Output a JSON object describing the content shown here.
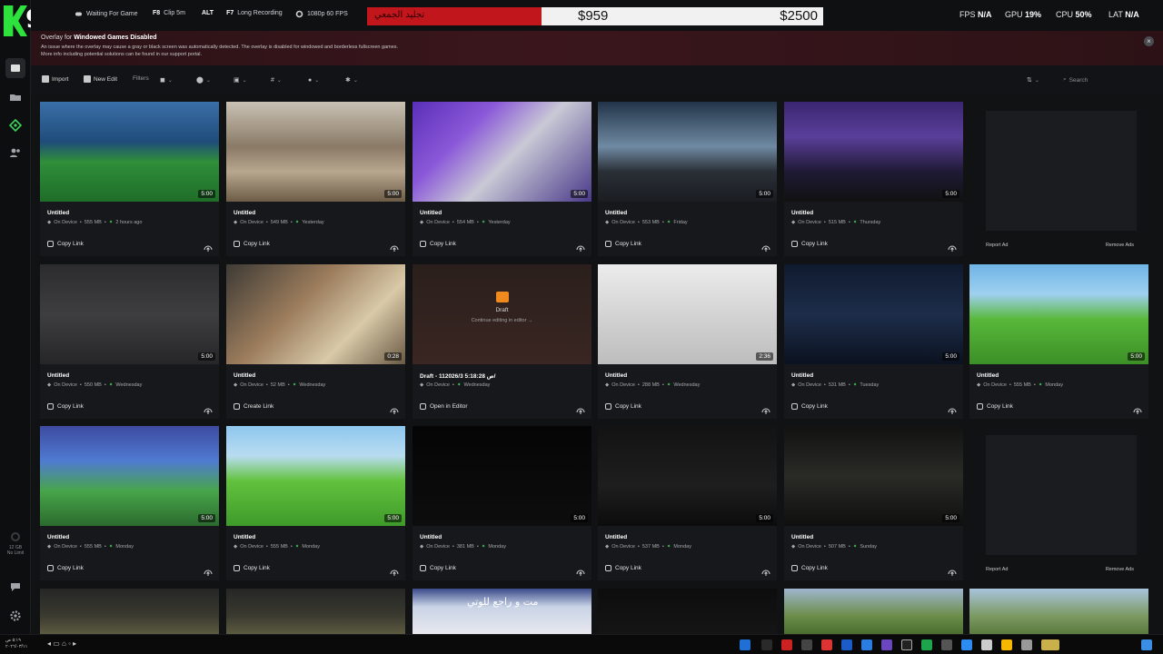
{
  "app": {
    "logo_text": "9"
  },
  "rail": {
    "storage_text": "12 GB",
    "limit_text": "No Limit"
  },
  "topbar": {
    "status": "Waiting For Game",
    "clip_key": "F8",
    "clip_label": "Clip 5m",
    "alt_key": "ALT",
    "long_key": "F7",
    "long_label": "Long Recording",
    "quality": "1080p 60 FPS",
    "bid_text": "تجليد الجمعي",
    "amount_current": "$959",
    "amount_goal": "$2500",
    "fps_label": "FPS",
    "fps_value": "N/A",
    "gpu_label": "GPU",
    "gpu_value": "19%",
    "cpu_label": "CPU",
    "cpu_value": "50%",
    "lat_label": "LAT",
    "lat_value": "N/A"
  },
  "banner": {
    "title_prefix": "Overlay for",
    "title_bold": "Windowed Games Disabled",
    "line1": "An issue where the overlay may cause a gray or black screen was automatically detected. The overlay is disabled for windowed and borderless fullscreen games.",
    "line2": "More info including potential solutions can be found in our support portal.",
    "close": "×"
  },
  "toolbar": {
    "import": "Import",
    "new_edit": "New Edit",
    "filters": "Filters",
    "search_placeholder": "Search"
  },
  "ads": {
    "report": "Report Ad",
    "remove": "Remove Ads"
  },
  "cards": [
    {
      "title": "Untitled",
      "size": "555 MB",
      "when": "2 hours ago",
      "duration": "5:00",
      "action": "Copy Link",
      "location": "On Device"
    },
    {
      "title": "Untitled",
      "size": "549 MB",
      "when": "Yesterday",
      "duration": "5:00",
      "action": "Copy Link",
      "location": "On Device"
    },
    {
      "title": "Untitled",
      "size": "554 MB",
      "when": "Yesterday",
      "duration": "5:00",
      "action": "Copy Link",
      "location": "On Device"
    },
    {
      "title": "Untitled",
      "size": "553 MB",
      "when": "Friday",
      "duration": "5:00",
      "action": "Copy Link",
      "location": "On Device"
    },
    {
      "title": "Untitled",
      "size": "515 MB",
      "when": "Thursday",
      "duration": "5:00",
      "action": "Copy Link",
      "location": "On Device"
    },
    {
      "title": "Untitled",
      "size": "550 MB",
      "when": "Wednesday",
      "duration": "5:00",
      "action": "Copy Link",
      "location": "On Device"
    },
    {
      "title": "Untitled",
      "size": "52 MB",
      "when": "Wednesday",
      "duration": "0:28",
      "action": "Create Link",
      "location": "On Device"
    },
    {
      "title": "Draft - 11ص 5:18:28 2026/3/",
      "size": "",
      "when": "Wednesday",
      "duration": "",
      "action": "Open in Editor",
      "location": "On Device",
      "draft_label": "Draft",
      "draft_sub": "Continue editing in editor →"
    },
    {
      "title": "Untitled",
      "size": "288 MB",
      "when": "Wednesday",
      "duration": "2:36",
      "action": "Copy Link",
      "location": "On Device"
    },
    {
      "title": "Untitled",
      "size": "531 MB",
      "when": "Tuesday",
      "duration": "5:00",
      "action": "Copy Link",
      "location": "On Device"
    },
    {
      "title": "Untitled",
      "size": "555 MB",
      "when": "Monday",
      "duration": "5:00",
      "action": "Copy Link",
      "location": "On Device"
    },
    {
      "title": "Untitled",
      "size": "555 MB",
      "when": "Monday",
      "duration": "5:00",
      "action": "Copy Link",
      "location": "On Device"
    },
    {
      "title": "Untitled",
      "size": "555 MB",
      "when": "Monday",
      "duration": "5:00",
      "action": "Copy Link",
      "location": "On Device"
    },
    {
      "title": "Untitled",
      "size": "381 MB",
      "when": "Monday",
      "duration": "5:00",
      "action": "Copy Link",
      "location": "On Device"
    },
    {
      "title": "Untitled",
      "size": "537 MB",
      "when": "Monday",
      "duration": "5:00",
      "action": "Copy Link",
      "location": "On Device"
    },
    {
      "title": "Untitled",
      "size": "507 MB",
      "when": "Sunday",
      "duration": "5:00",
      "action": "Copy Link",
      "location": "On Device"
    }
  ],
  "bottom_overlay_text": "مت و راجع للوتي",
  "clock": {
    "time": "٥:١٩ ص",
    "date": "٢٠٢٦/٠٣/١١"
  }
}
